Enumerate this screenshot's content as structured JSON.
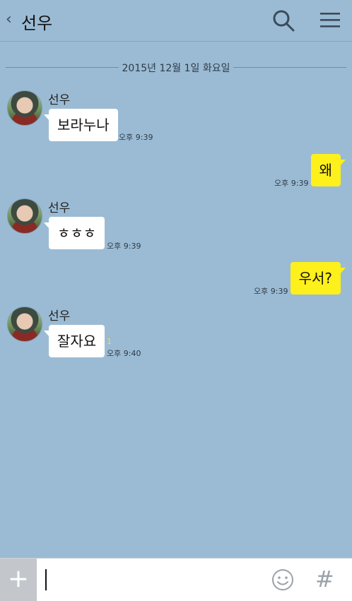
{
  "header": {
    "back_glyph": "‹",
    "title": "선우"
  },
  "date_separator": "2015년 12월 1일 화요일",
  "messages": [
    {
      "sender": "선우",
      "text": "보라누나",
      "time": "오후 9:39"
    },
    {
      "text": "왜",
      "time": "오후 9:39"
    },
    {
      "sender": "선우",
      "text": "ㅎㅎㅎ",
      "time": "오후 9:39"
    },
    {
      "text": "우서?",
      "time": "오후 9:39"
    },
    {
      "sender": "선우",
      "text": "잘자요",
      "time": "오후 9:40",
      "unread": "1"
    }
  ],
  "input": {
    "plus_label": "+",
    "hash_label": "#"
  },
  "colors": {
    "background": "#9bbbd4",
    "outgoing_bubble": "#fef01b",
    "incoming_bubble": "#ffffff"
  }
}
